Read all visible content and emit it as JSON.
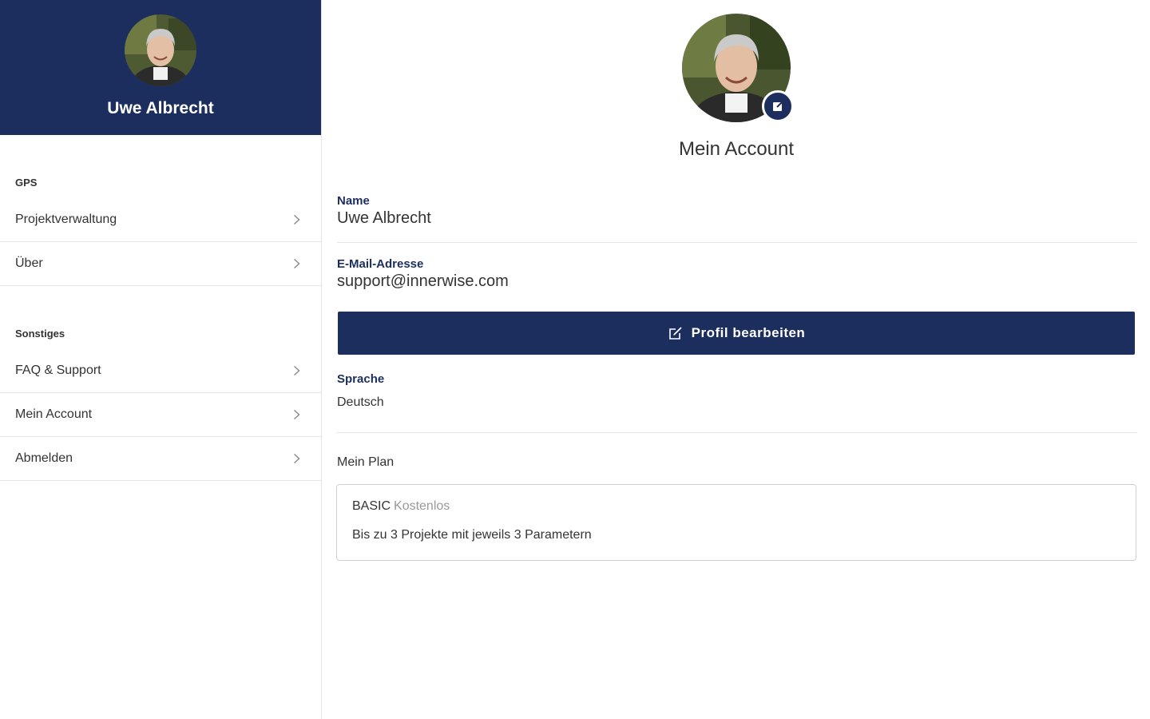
{
  "user": {
    "name": "Uwe Albrecht"
  },
  "sidebar": {
    "sections": [
      {
        "label": "GPS",
        "items": [
          {
            "label": "Projektverwaltung"
          },
          {
            "label": "Über"
          }
        ]
      },
      {
        "label": "Sonstiges",
        "items": [
          {
            "label": "FAQ & Support"
          },
          {
            "label": "Mein Account"
          },
          {
            "label": "Abmelden"
          }
        ]
      }
    ]
  },
  "account": {
    "title": "Mein Account",
    "name_label": "Name",
    "name_value": "Uwe Albrecht",
    "email_label": "E-Mail-Adresse",
    "email_value": "support@innerwise.com",
    "edit_button_label": "Profil bearbeiten",
    "language_label": "Sprache",
    "language_value": "Deutsch",
    "plan_heading": "Mein Plan",
    "plan": {
      "name": "BASIC",
      "price": "Kostenlos",
      "description": "Bis zu 3 Projekte mit jeweils 3 Parametern"
    }
  },
  "colors": {
    "brand": "#1c2e5e",
    "divider": "#e6e6e6",
    "muted": "#999999"
  },
  "icons": {
    "chevron": "chevron-right-icon",
    "edit": "edit-icon",
    "avatar": "user-photo"
  }
}
